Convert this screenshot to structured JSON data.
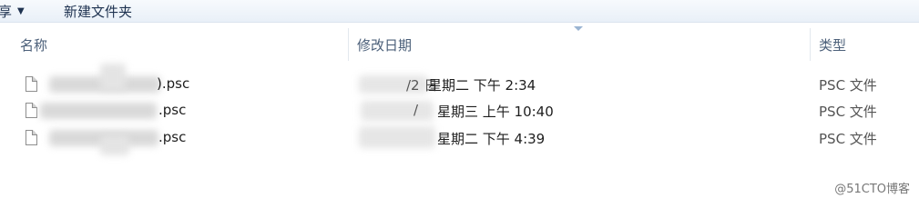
{
  "toolbar": {
    "share_label": "享",
    "share_caret": "▼",
    "new_folder_label": "新建文件夹"
  },
  "columns": {
    "name": "名称",
    "modified": "修改日期",
    "type": "类型"
  },
  "rows": [
    {
      "name_suffix": ").psc",
      "date_visible": "星期二 下午 2:34",
      "date_prefix": "/2 日",
      "type": "PSC 文件"
    },
    {
      "name_suffix": ".psc",
      "date_visible": "星期三 上午 10:40",
      "date_prefix": "/",
      "type": "PSC 文件"
    },
    {
      "name_suffix": ".psc",
      "date_visible": "星期二 下午 4:39",
      "date_prefix": "",
      "type": "PSC 文件"
    }
  ],
  "watermark": "@51CTO博客"
}
